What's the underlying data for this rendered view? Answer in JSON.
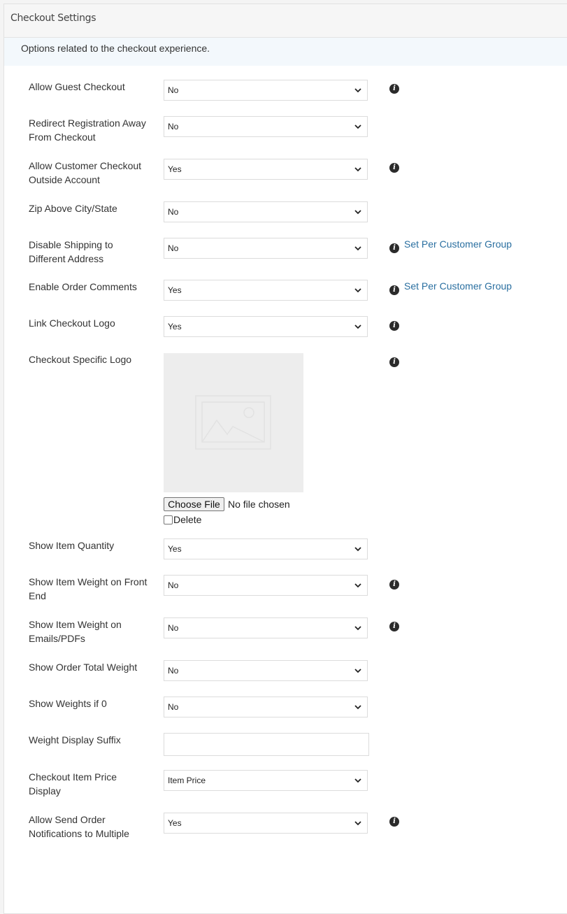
{
  "panel": {
    "title": "Checkout Settings",
    "description": "Options related to the checkout experience."
  },
  "fields": [
    {
      "label": "Allow Guest Checkout",
      "value": "No",
      "info": true
    },
    {
      "label": "Redirect Registration Away From Checkout",
      "value": "No",
      "info": false
    },
    {
      "label": "Allow Customer Checkout Outside Account",
      "value": "Yes",
      "info": true
    },
    {
      "label": "Zip Above City/State",
      "value": "No",
      "info": false
    },
    {
      "label": "Disable Shipping to Different Address",
      "value": "No",
      "info": true,
      "link": "Set Per Customer Group"
    },
    {
      "label": "Enable Order Comments",
      "value": "Yes",
      "info": true,
      "link": "Set Per Customer Group"
    },
    {
      "label": "Link Checkout Logo",
      "value": "Yes",
      "info": true
    },
    {
      "label": "Checkout Specific Logo",
      "info": true
    },
    {
      "label": "Show Item Quantity",
      "value": "Yes",
      "info": false
    },
    {
      "label": "Show Item Weight on Front End",
      "value": "No",
      "info": true
    },
    {
      "label": "Show Item Weight on Emails/PDFs",
      "value": "No",
      "info": true
    },
    {
      "label": "Show Order Total Weight",
      "value": "No",
      "info": false
    },
    {
      "label": "Show Weights if 0",
      "value": "No",
      "info": false
    },
    {
      "label": "Weight Display Suffix",
      "value": "",
      "info": false
    },
    {
      "label": "Checkout Item Price Display",
      "value": "Item Price",
      "info": false
    },
    {
      "label": "Allow Send Order Notifications to Multiple",
      "value": "Yes",
      "info": true
    }
  ],
  "logo_upload": {
    "choose_file_label": "Choose File",
    "file_status": "No file chosen",
    "delete_label": "Delete",
    "delete_checked": false
  },
  "icons": {
    "info": "info-circle-icon",
    "dropdown": "chevron-down-icon",
    "placeholder": "image-placeholder-icon"
  },
  "colors": {
    "link": "#2a6fa0",
    "header_bg": "#f6f6f6",
    "description_bg": "#f3f8fc"
  }
}
